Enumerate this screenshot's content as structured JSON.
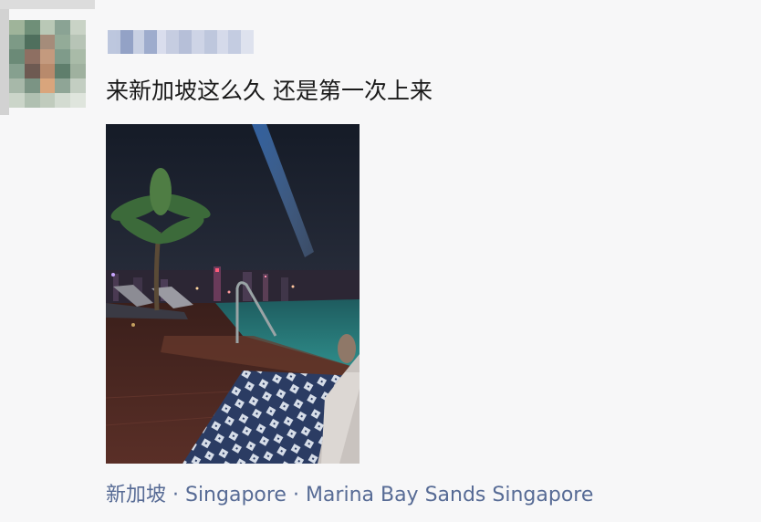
{
  "post": {
    "text": "来新加坡这么久 还是第一次上来",
    "location": "新加坡 · Singapore · Marina Bay Sands Singapore"
  },
  "colors": {
    "location_link": "#576b95",
    "post_text": "#1b1b1b",
    "background": "#f7f7f8"
  }
}
